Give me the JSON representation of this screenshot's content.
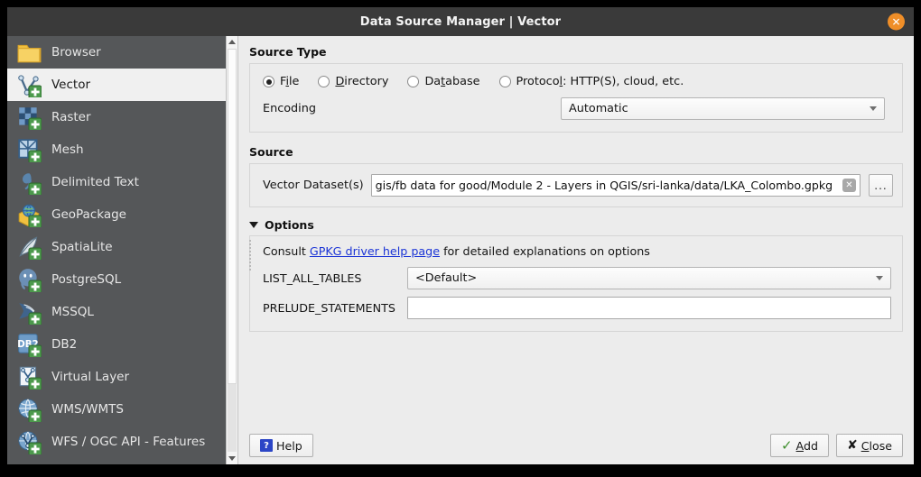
{
  "window": {
    "title": "Data Source Manager | Vector",
    "close_icon": "close-icon",
    "close_label": "✕"
  },
  "sidebar": {
    "items": [
      {
        "label": "Browser",
        "icon": "folder-icon",
        "selected": false
      },
      {
        "label": "Vector",
        "icon": "vector-layer-icon",
        "selected": true
      },
      {
        "label": "Raster",
        "icon": "raster-layer-icon",
        "selected": false
      },
      {
        "label": "Mesh",
        "icon": "mesh-layer-icon",
        "selected": false
      },
      {
        "label": "Delimited Text",
        "icon": "delimited-text-icon",
        "selected": false
      },
      {
        "label": "GeoPackage",
        "icon": "geopackage-icon",
        "selected": false
      },
      {
        "label": "SpatiaLite",
        "icon": "spatialite-icon",
        "selected": false
      },
      {
        "label": "PostgreSQL",
        "icon": "postgresql-icon",
        "selected": false
      },
      {
        "label": "MSSQL",
        "icon": "mssql-icon",
        "selected": false
      },
      {
        "label": "DB2",
        "icon": "db2-icon",
        "selected": false
      },
      {
        "label": "Virtual Layer",
        "icon": "virtual-layer-icon",
        "selected": false
      },
      {
        "label": "WMS/WMTS",
        "icon": "wms-wmts-icon",
        "selected": false
      },
      {
        "label": "WFS / OGC API - Features",
        "icon": "wfs-ogc-api-icon",
        "selected": false
      }
    ]
  },
  "source_type": {
    "heading": "Source Type",
    "radios": [
      {
        "pre": "F",
        "acc": "i",
        "post": "le",
        "checked": true
      },
      {
        "pre": "",
        "acc": "D",
        "post": "irectory",
        "checked": false
      },
      {
        "pre": "Da",
        "acc": "t",
        "post": "abase",
        "checked": false
      },
      {
        "pre": "Protoco",
        "acc": "l",
        "post": ": HTTP(S), cloud, etc.",
        "checked": false
      }
    ],
    "encoding_label": "Encoding",
    "encoding_value": "Automatic"
  },
  "source": {
    "heading": "Source",
    "dataset_label": "Vector Dataset(s)",
    "dataset_value": "gis/fb data for good/Module 2 - Layers in QGIS/sri-lanka/data/LKA_Colombo.gpkg",
    "clear_icon": "clear-icon",
    "clear_label": "✕",
    "browse_label": "..."
  },
  "options": {
    "heading": "Options",
    "consult_pre": "Consult ",
    "consult_link": "GPKG driver help page",
    "consult_post": " for detailed explanations on options",
    "rows": [
      {
        "label": "LIST_ALL_TABLES",
        "value": "<Default>",
        "type": "combo"
      },
      {
        "label": "PRELUDE_STATEMENTS",
        "value": "",
        "type": "text"
      }
    ]
  },
  "buttons": {
    "help_label": "Help",
    "help_glyph": "?",
    "add_pre": "",
    "add_acc": "A",
    "add_post": "dd",
    "add_glyph": "✓",
    "close_pre": "",
    "close_acc": "C",
    "close_post": "lose",
    "close_glyph": "✘"
  },
  "colors": {
    "titlebar_bg": "#3a3a3a",
    "sidebar_bg": "#555759",
    "dialog_bg": "#ececec",
    "accent_close": "#ef8e28",
    "link": "#1b34d6",
    "add_check": "#3f8f2e",
    "help_blue": "#2b45c6"
  }
}
